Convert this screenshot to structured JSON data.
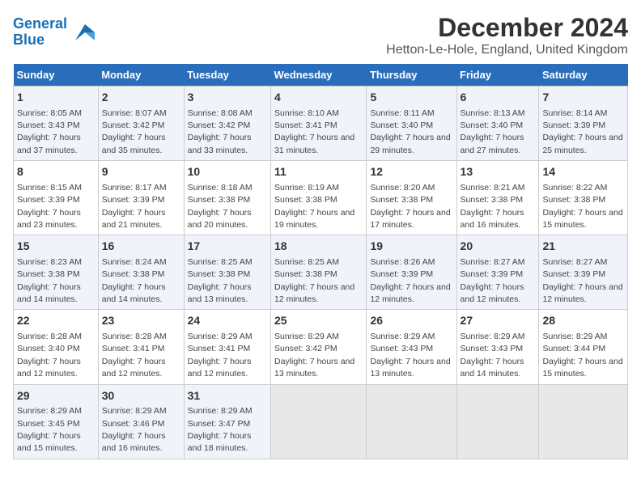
{
  "logo": {
    "line1": "General",
    "line2": "Blue"
  },
  "title": "December 2024",
  "subtitle": "Hetton-Le-Hole, England, United Kingdom",
  "days_of_week": [
    "Sunday",
    "Monday",
    "Tuesday",
    "Wednesday",
    "Thursday",
    "Friday",
    "Saturday"
  ],
  "weeks": [
    [
      {
        "day": 1,
        "sunrise": "8:05 AM",
        "sunset": "3:43 PM",
        "daylight": "7 hours and 37 minutes."
      },
      {
        "day": 2,
        "sunrise": "8:07 AM",
        "sunset": "3:42 PM",
        "daylight": "7 hours and 35 minutes."
      },
      {
        "day": 3,
        "sunrise": "8:08 AM",
        "sunset": "3:42 PM",
        "daylight": "7 hours and 33 minutes."
      },
      {
        "day": 4,
        "sunrise": "8:10 AM",
        "sunset": "3:41 PM",
        "daylight": "7 hours and 31 minutes."
      },
      {
        "day": 5,
        "sunrise": "8:11 AM",
        "sunset": "3:40 PM",
        "daylight": "7 hours and 29 minutes."
      },
      {
        "day": 6,
        "sunrise": "8:13 AM",
        "sunset": "3:40 PM",
        "daylight": "7 hours and 27 minutes."
      },
      {
        "day": 7,
        "sunrise": "8:14 AM",
        "sunset": "3:39 PM",
        "daylight": "7 hours and 25 minutes."
      }
    ],
    [
      {
        "day": 8,
        "sunrise": "8:15 AM",
        "sunset": "3:39 PM",
        "daylight": "7 hours and 23 minutes."
      },
      {
        "day": 9,
        "sunrise": "8:17 AM",
        "sunset": "3:39 PM",
        "daylight": "7 hours and 21 minutes."
      },
      {
        "day": 10,
        "sunrise": "8:18 AM",
        "sunset": "3:38 PM",
        "daylight": "7 hours and 20 minutes."
      },
      {
        "day": 11,
        "sunrise": "8:19 AM",
        "sunset": "3:38 PM",
        "daylight": "7 hours and 19 minutes."
      },
      {
        "day": 12,
        "sunrise": "8:20 AM",
        "sunset": "3:38 PM",
        "daylight": "7 hours and 17 minutes."
      },
      {
        "day": 13,
        "sunrise": "8:21 AM",
        "sunset": "3:38 PM",
        "daylight": "7 hours and 16 minutes."
      },
      {
        "day": 14,
        "sunrise": "8:22 AM",
        "sunset": "3:38 PM",
        "daylight": "7 hours and 15 minutes."
      }
    ],
    [
      {
        "day": 15,
        "sunrise": "8:23 AM",
        "sunset": "3:38 PM",
        "daylight": "7 hours and 14 minutes."
      },
      {
        "day": 16,
        "sunrise": "8:24 AM",
        "sunset": "3:38 PM",
        "daylight": "7 hours and 14 minutes."
      },
      {
        "day": 17,
        "sunrise": "8:25 AM",
        "sunset": "3:38 PM",
        "daylight": "7 hours and 13 minutes."
      },
      {
        "day": 18,
        "sunrise": "8:25 AM",
        "sunset": "3:38 PM",
        "daylight": "7 hours and 12 minutes."
      },
      {
        "day": 19,
        "sunrise": "8:26 AM",
        "sunset": "3:39 PM",
        "daylight": "7 hours and 12 minutes."
      },
      {
        "day": 20,
        "sunrise": "8:27 AM",
        "sunset": "3:39 PM",
        "daylight": "7 hours and 12 minutes."
      },
      {
        "day": 21,
        "sunrise": "8:27 AM",
        "sunset": "3:39 PM",
        "daylight": "7 hours and 12 minutes."
      }
    ],
    [
      {
        "day": 22,
        "sunrise": "8:28 AM",
        "sunset": "3:40 PM",
        "daylight": "7 hours and 12 minutes."
      },
      {
        "day": 23,
        "sunrise": "8:28 AM",
        "sunset": "3:41 PM",
        "daylight": "7 hours and 12 minutes."
      },
      {
        "day": 24,
        "sunrise": "8:29 AM",
        "sunset": "3:41 PM",
        "daylight": "7 hours and 12 minutes."
      },
      {
        "day": 25,
        "sunrise": "8:29 AM",
        "sunset": "3:42 PM",
        "daylight": "7 hours and 13 minutes."
      },
      {
        "day": 26,
        "sunrise": "8:29 AM",
        "sunset": "3:43 PM",
        "daylight": "7 hours and 13 minutes."
      },
      {
        "day": 27,
        "sunrise": "8:29 AM",
        "sunset": "3:43 PM",
        "daylight": "7 hours and 14 minutes."
      },
      {
        "day": 28,
        "sunrise": "8:29 AM",
        "sunset": "3:44 PM",
        "daylight": "7 hours and 15 minutes."
      }
    ],
    [
      {
        "day": 29,
        "sunrise": "8:29 AM",
        "sunset": "3:45 PM",
        "daylight": "7 hours and 15 minutes."
      },
      {
        "day": 30,
        "sunrise": "8:29 AM",
        "sunset": "3:46 PM",
        "daylight": "7 hours and 16 minutes."
      },
      {
        "day": 31,
        "sunrise": "8:29 AM",
        "sunset": "3:47 PM",
        "daylight": "7 hours and 18 minutes."
      },
      null,
      null,
      null,
      null
    ]
  ]
}
